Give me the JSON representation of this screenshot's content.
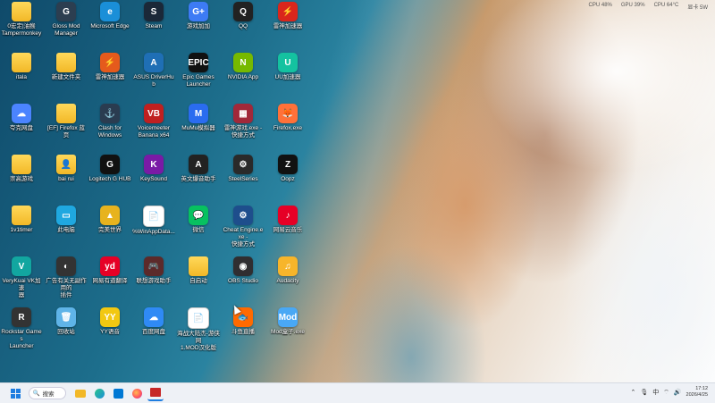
{
  "sysinfo": [
    "CPU 48%",
    "GPU 39%",
    "CPU 64°C",
    "显卡 5W"
  ],
  "icons": [
    {
      "label": "0宏定|油猴\nTampermonkey",
      "color": "#f2b827",
      "glyph": "",
      "folder": true
    },
    {
      "label": "Gloss Mod\nManager",
      "color": "#2c3e50",
      "glyph": "G"
    },
    {
      "label": "Microsoft Edge",
      "color": "#1a8fd8",
      "glyph": "e"
    },
    {
      "label": "Steam",
      "color": "#1b2838",
      "glyph": "S"
    },
    {
      "label": "游戏加加",
      "color": "#3d7bf5",
      "glyph": "G+"
    },
    {
      "label": "QQ",
      "color": "#222",
      "glyph": "Q"
    },
    {
      "label": "雷神加速器",
      "color": "#d9261c",
      "glyph": "⚡"
    },
    {
      "label": "itala",
      "color": "#f2b827",
      "glyph": "",
      "folder": true
    },
    {
      "label": "新建文件夹",
      "color": "#f2b827",
      "glyph": "",
      "folder": true
    },
    {
      "label": "雷神加速器",
      "color": "#e55a1c",
      "glyph": "⚡"
    },
    {
      "label": "ASUS DriverHub",
      "color": "#1f6fb5",
      "glyph": "A"
    },
    {
      "label": "Epic Games\nLauncher",
      "color": "#111",
      "glyph": "EPIC"
    },
    {
      "label": "NVIDIA App",
      "color": "#76b900",
      "glyph": "N"
    },
    {
      "label": "UU加速器",
      "color": "#14c2a0",
      "glyph": "U"
    },
    {
      "label": "夸克网盘",
      "color": "#4b84ff",
      "glyph": "☁"
    },
    {
      "label": "[EF] Firefox 蓝页",
      "color": "#f2b827",
      "glyph": "",
      "folder": true
    },
    {
      "label": "Clash for\nWindows",
      "color": "#2a3c50",
      "glyph": "⚓"
    },
    {
      "label": "Voicemeeter\nBanana x64",
      "color": "#c02020",
      "glyph": "VB"
    },
    {
      "label": "MuMu模拟器",
      "color": "#2a6cf0",
      "glyph": "M"
    },
    {
      "label": "雷神游戏.exe -\n快捷方式",
      "color": "#a1283a",
      "glyph": "▦"
    },
    {
      "label": "Firefox.exe",
      "color": "#ff7139",
      "glyph": "🦊"
    },
    {
      "label": "崇高游戏",
      "color": "#f2b827",
      "glyph": "",
      "folder": true
    },
    {
      "label": "bai rui",
      "color": "#f2b827",
      "glyph": "👤",
      "folder": true
    },
    {
      "label": "Logitech G HUB",
      "color": "#111",
      "glyph": "G"
    },
    {
      "label": "KeySound",
      "color": "#7a1aa6",
      "glyph": "K"
    },
    {
      "label": "英文爆音助手",
      "color": "#222",
      "glyph": "A"
    },
    {
      "label": "SteelSeries",
      "color": "#2a2a2a",
      "glyph": "⚙"
    },
    {
      "label": "Oopz",
      "color": "#111",
      "glyph": "Z"
    },
    {
      "label": "1v1timer",
      "color": "#f2b827",
      "glyph": "",
      "folder": true
    },
    {
      "label": "此电脑",
      "color": "#1fa8e0",
      "glyph": "▭"
    },
    {
      "label": "完美世界",
      "color": "#e7b31e",
      "glyph": "▲"
    },
    {
      "label": "%WinAppData...",
      "color": "#ffffff",
      "glyph": "📄"
    },
    {
      "label": "微信",
      "color": "#07c160",
      "glyph": "💬"
    },
    {
      "label": "Cheat Engine.exe -\n快捷方式",
      "color": "#1e4e8c",
      "glyph": "⚙"
    },
    {
      "label": "网易云音乐",
      "color": "#e60026",
      "glyph": "♪"
    },
    {
      "label": "VeryKuai VK加速\n器",
      "color": "#12a6a0",
      "glyph": "V"
    },
    {
      "label": "广告有关无副作用的\n插件",
      "color": "#333",
      "glyph": "◐"
    },
    {
      "label": "网易有道翻译",
      "color": "#e60026",
      "glyph": "yd"
    },
    {
      "label": "联想游戏助手",
      "color": "#5c2a2a",
      "glyph": "🎮"
    },
    {
      "label": "自启动",
      "color": "#f2b827",
      "glyph": "",
      "folder": true
    },
    {
      "label": "OBS Studio",
      "color": "#302e31",
      "glyph": "◉"
    },
    {
      "label": "Audacity",
      "color": "#f7b52a",
      "glyph": "♫"
    },
    {
      "label": "Rockstar Games\nLauncher",
      "color": "#333",
      "glyph": "R"
    },
    {
      "label": "回收站",
      "color": "#5fb4e8",
      "glyph": "🗑"
    },
    {
      "label": "YY语音",
      "color": "#f2c811",
      "glyph": "YY"
    },
    {
      "label": "百度网盘",
      "color": "#2f8af5",
      "glyph": "☁"
    },
    {
      "label": "海战大陆杰-游侠网\n1.MOD汉化版",
      "color": "#ffffff",
      "glyph": "📄"
    },
    {
      "label": "斗鱼直播",
      "color": "#ff6a00",
      "glyph": "🐟"
    },
    {
      "label": "Mod盒子.exe",
      "color": "#49a8f5",
      "glyph": "Mod"
    }
  ],
  "taskbar": {
    "start_label": "开始",
    "search_placeholder": "搜索",
    "apps": [
      "file-explorer",
      "edge",
      "store",
      "firefox",
      "media"
    ],
    "tray": {
      "input": "中",
      "time": "17:12",
      "date": "2026/4/25"
    }
  }
}
